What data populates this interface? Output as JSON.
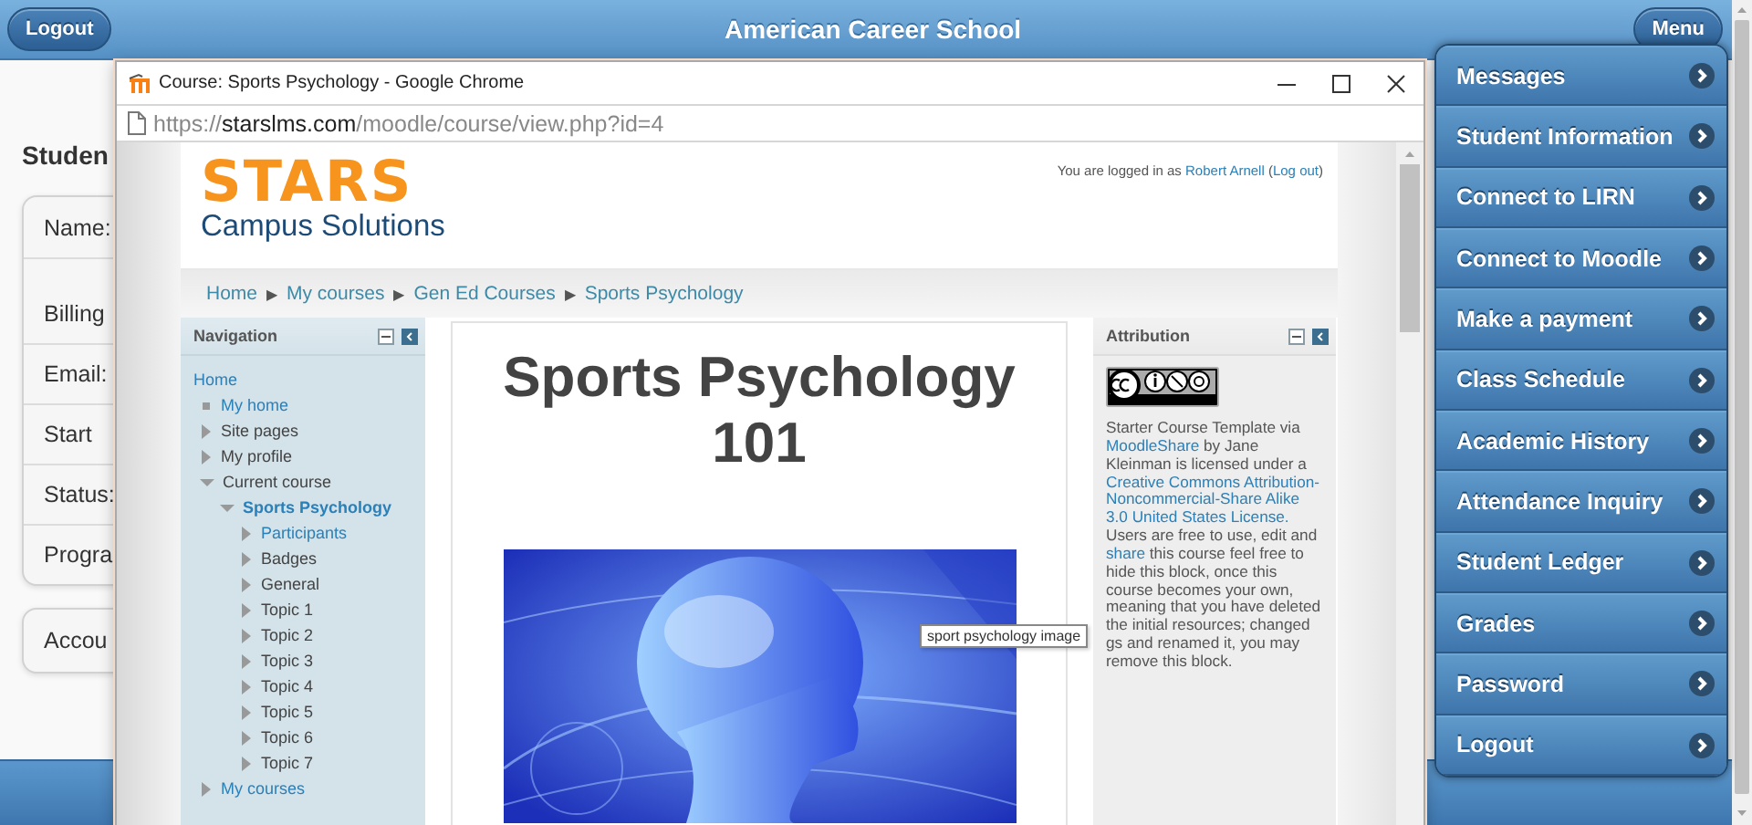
{
  "app": {
    "logout_button": "Logout",
    "title": "American Career School",
    "menu_button": "Menu"
  },
  "student_page": {
    "heading": "Studen",
    "details": [
      {
        "label": "Name:"
      },
      {
        "label": "Billing"
      },
      {
        "label": "Email:"
      },
      {
        "label": "Start"
      },
      {
        "label": "Status:"
      },
      {
        "label": "Progra"
      }
    ],
    "account_card": {
      "label": "Accou"
    }
  },
  "browser": {
    "title": "Course: Sports Psychology - Google Chrome",
    "address": {
      "scheme": "https://",
      "host": "starslms.com",
      "path": "/moodle/course/view.php?id=4"
    }
  },
  "moodle": {
    "logo": {
      "name": "STARS",
      "tagline": "Campus Solutions"
    },
    "login_info": [
      {
        "text": "You are logged in as ",
        "kind": "text"
      },
      {
        "text": "Robert Arnell",
        "kind": "link"
      },
      {
        "text": " (",
        "kind": "text"
      },
      {
        "text": "Log out",
        "kind": "link"
      },
      {
        "text": ")",
        "kind": "text"
      }
    ],
    "breadcrumb": [
      {
        "kind": "link",
        "text": "Home"
      },
      {
        "kind": "separator",
        "text": "▶"
      },
      {
        "kind": "link",
        "text": "My courses"
      },
      {
        "kind": "separator",
        "text": "▶"
      },
      {
        "kind": "link",
        "text": "Gen Ed Courses"
      },
      {
        "kind": "separator",
        "text": "▶"
      },
      {
        "kind": "link",
        "text": "Sports Psychology"
      }
    ],
    "navigation": {
      "title": "Navigation",
      "tree": [
        {
          "label": "Home",
          "kind": "plain",
          "link": true,
          "children": [
            {
              "label": "My home",
              "kind": "bullet",
              "link": true
            },
            {
              "label": "Site pages",
              "kind": "branch",
              "expanded": false,
              "link": false
            },
            {
              "label": "My profile",
              "kind": "branch",
              "expanded": false,
              "link": false
            },
            {
              "label": "Current course",
              "kind": "branch",
              "expanded": true,
              "link": false,
              "children": [
                {
                  "label": "Sports Psychology",
                  "kind": "branch",
                  "expanded": true,
                  "link": true,
                  "current": true,
                  "children": [
                    {
                      "label": "Participants",
                      "kind": "branch",
                      "expanded": false,
                      "link": true
                    },
                    {
                      "label": "Badges",
                      "kind": "branch",
                      "expanded": false,
                      "link": false
                    },
                    {
                      "label": "General",
                      "kind": "branch",
                      "expanded": false,
                      "link": false
                    },
                    {
                      "label": "Topic 1",
                      "kind": "branch",
                      "expanded": false,
                      "link": false
                    },
                    {
                      "label": "Topic 2",
                      "kind": "branch",
                      "expanded": false,
                      "link": false
                    },
                    {
                      "label": "Topic 3",
                      "kind": "branch",
                      "expanded": false,
                      "link": false
                    },
                    {
                      "label": "Topic 4",
                      "kind": "branch",
                      "expanded": false,
                      "link": false
                    },
                    {
                      "label": "Topic 5",
                      "kind": "branch",
                      "expanded": false,
                      "link": false
                    },
                    {
                      "label": "Topic 6",
                      "kind": "branch",
                      "expanded": false,
                      "link": false
                    },
                    {
                      "label": "Topic 7",
                      "kind": "branch",
                      "expanded": false,
                      "link": false
                    }
                  ]
                }
              ]
            },
            {
              "label": "My courses",
              "kind": "branch",
              "expanded": false,
              "link": true
            }
          ]
        }
      ]
    },
    "course": {
      "title": "Sports Psychology 101",
      "image": {
        "kind": "picture",
        "tooltip": "sport psychology image"
      }
    },
    "attribution": {
      "title": "Attribution",
      "text": [
        {
          "text": "Starter Course Template via ",
          "kind": "text"
        },
        {
          "text": "MoodleShare",
          "kind": "link"
        },
        {
          "text": " by Jane Kleinman is licensed under a ",
          "kind": "text"
        },
        {
          "text": "Creative Commons Attribution-",
          "kind": "link"
        },
        {
          "text": "Noncommercial-Share Alike ",
          "kind": "link"
        },
        {
          "text": "3.0 United States License.",
          "kind": "link"
        },
        {
          "text": " Users are free to use, edit and ",
          "kind": "text"
        },
        {
          "text": "share",
          "kind": "link"
        },
        {
          "text": " this course feel free to hide this block, once this course becomes your own, meaning that you have deleted the initial resources; changed gs and renamed it, you may remove this block.",
          "kind": "text"
        }
      ]
    }
  },
  "menu": [
    {
      "label": "Messages"
    },
    {
      "label": "Student Information"
    },
    {
      "label": "Connect to LIRN"
    },
    {
      "label": "Connect to Moodle"
    },
    {
      "label": "Make a payment"
    },
    {
      "label": "Class Schedule"
    },
    {
      "label": "Academic History"
    },
    {
      "label": "Attendance Inquiry"
    },
    {
      "label": "Student Ledger"
    },
    {
      "label": "Grades"
    },
    {
      "label": "Password"
    },
    {
      "label": "Logout"
    }
  ]
}
